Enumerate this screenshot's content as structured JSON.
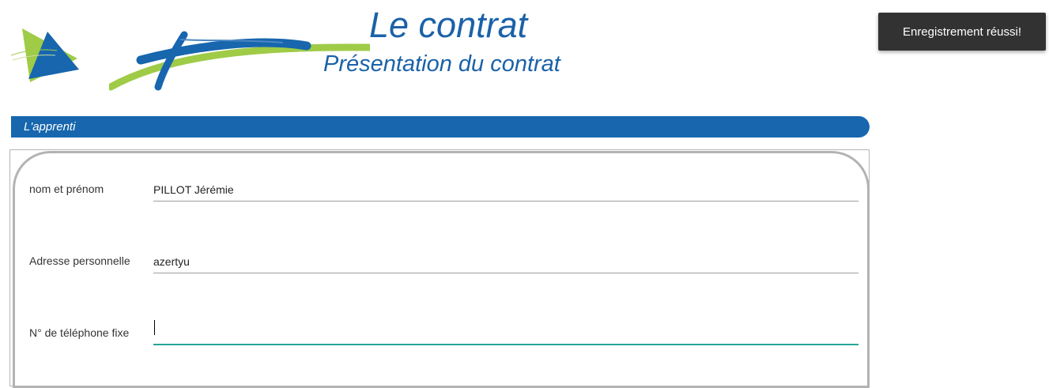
{
  "header": {
    "title": "Le contrat",
    "subtitle": "Présentation du contrat",
    "colors": {
      "primary_blue": "#1766ae",
      "logo_green": "#9fcb47"
    }
  },
  "section": {
    "title": "L'apprenti"
  },
  "form": {
    "fields": [
      {
        "label": "nom et prénom",
        "value": "PILLOT Jérémie"
      },
      {
        "label": "Adresse personnelle",
        "value": "azertyu"
      },
      {
        "label": "N° de téléphone fixe",
        "value": ""
      }
    ],
    "focus_color": "#26a69a"
  },
  "toast": {
    "message": "Enregistrement réussi!"
  }
}
